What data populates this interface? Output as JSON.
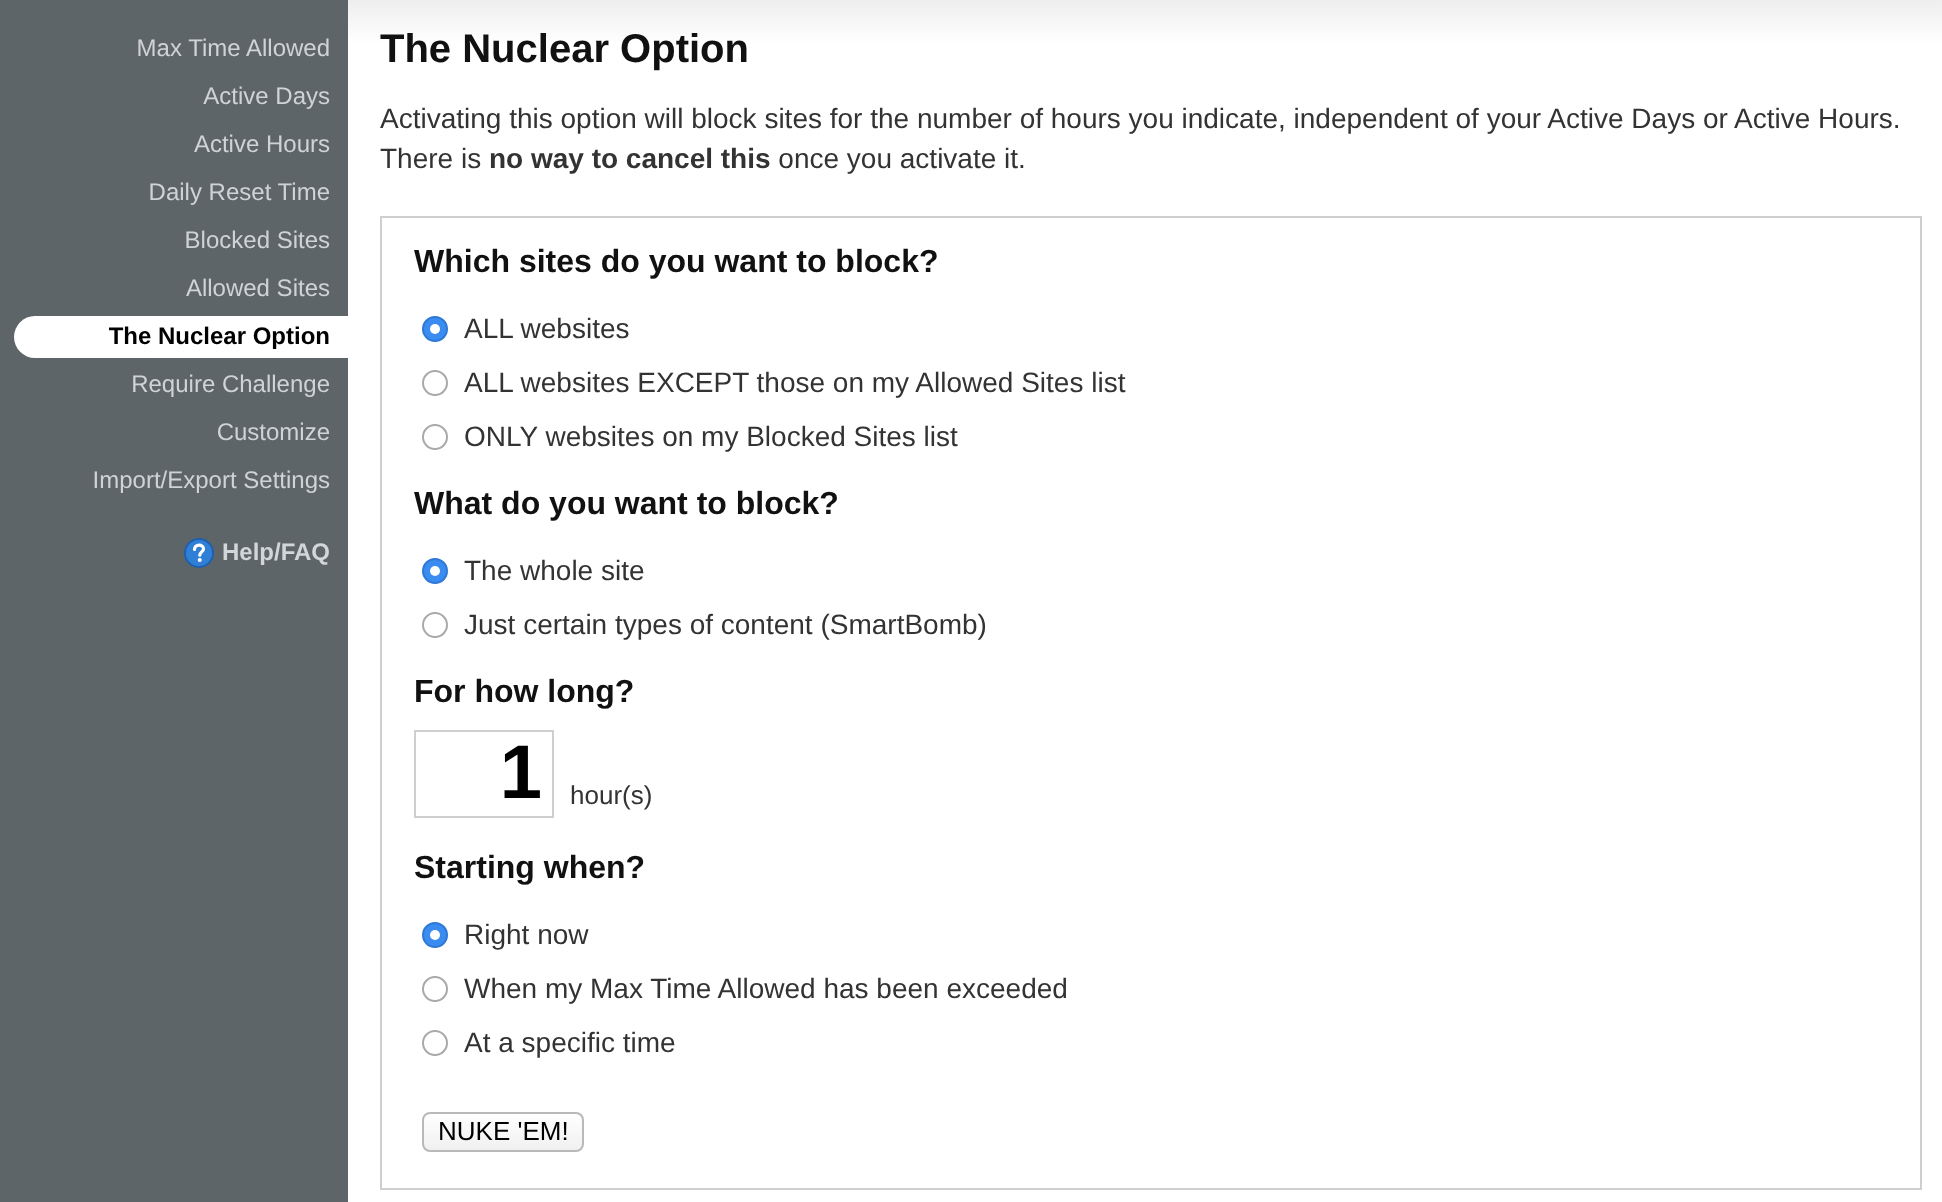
{
  "sidebar": {
    "items": [
      {
        "label": "Max Time Allowed",
        "selected": false
      },
      {
        "label": "Active Days",
        "selected": false
      },
      {
        "label": "Active Hours",
        "selected": false
      },
      {
        "label": "Daily Reset Time",
        "selected": false
      },
      {
        "label": "Blocked Sites",
        "selected": false
      },
      {
        "label": "Allowed Sites",
        "selected": false
      },
      {
        "label": "The Nuclear Option",
        "selected": true
      },
      {
        "label": "Require Challenge",
        "selected": false
      },
      {
        "label": "Customize",
        "selected": false
      },
      {
        "label": "Import/Export Settings",
        "selected": false
      }
    ],
    "help_link": {
      "label": "Help/FAQ"
    }
  },
  "page": {
    "title": "The Nuclear Option",
    "description": "Activating this option will block sites for the number of hours you indicate, independent of your Active Days or Active Hours. There is **no way to cancel this** once you activate it."
  },
  "form": {
    "sections": [
      {
        "kind": "radio",
        "heading": "Which sites do you want to block?",
        "options": [
          {
            "label": "ALL websites",
            "selected": true
          },
          {
            "label": "ALL websites EXCEPT those on my Allowed Sites list",
            "selected": false
          },
          {
            "label": "ONLY websites on my Blocked Sites list",
            "selected": false
          }
        ]
      },
      {
        "kind": "radio",
        "heading": "What do you want to block?",
        "options": [
          {
            "label": "The whole site",
            "selected": true
          },
          {
            "label": "Just certain types of content (SmartBomb)",
            "selected": false
          }
        ]
      },
      {
        "kind": "number",
        "heading": "For how long?",
        "value": "1",
        "unit": "hour(s)"
      },
      {
        "kind": "radio",
        "heading": "Starting when?",
        "options": [
          {
            "label": "Right now",
            "selected": true
          },
          {
            "label": "When my Max Time Allowed has been exceeded",
            "selected": false
          },
          {
            "label": "At a specific time",
            "selected": false
          }
        ]
      }
    ],
    "submit_button": "NUKE 'EM!"
  }
}
